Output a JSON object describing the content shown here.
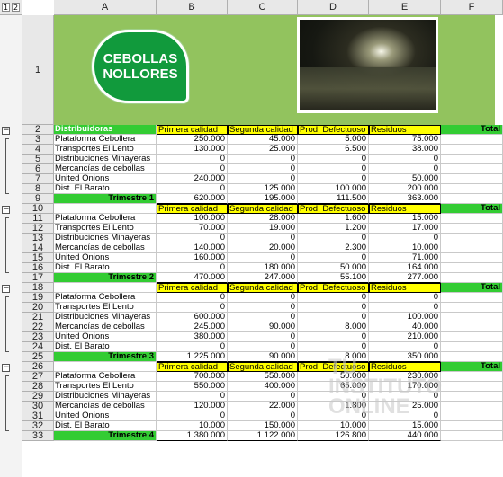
{
  "outline": {
    "levels": [
      "1",
      "2"
    ],
    "collapse_symbol": "−"
  },
  "columns": [
    "A",
    "B",
    "C",
    "D",
    "E",
    "F"
  ],
  "banner": {
    "logo_text": "CEBOLLAS NOLLORES",
    "row_label": "1"
  },
  "headers": {
    "a": "Distribuidoras",
    "b": "Primera calidad",
    "c": "Segunda calidad",
    "d": "Prod. Defectuoso",
    "e": "Residuos",
    "f": "Total"
  },
  "quarters": [
    {
      "header_row": "2",
      "rows": [
        {
          "row": "3",
          "name": "Plataforma Cebollera",
          "b": "250.000",
          "c": "45.000",
          "d": "5.000",
          "e": "75.000"
        },
        {
          "row": "4",
          "name": "Transportes El Lento",
          "b": "130.000",
          "c": "25.000",
          "d": "6.500",
          "e": "38.000"
        },
        {
          "row": "5",
          "name": "Distribuciones Minayeras",
          "b": "0",
          "c": "0",
          "d": "0",
          "e": "0"
        },
        {
          "row": "6",
          "name": "Mercancías de cebollas",
          "b": "0",
          "c": "0",
          "d": "0",
          "e": "0"
        },
        {
          "row": "7",
          "name": "United Onions",
          "b": "240.000",
          "c": "0",
          "d": "0",
          "e": "50.000"
        },
        {
          "row": "8",
          "name": "Dist. El Barato",
          "b": "0",
          "c": "125.000",
          "d": "100.000",
          "e": "200.000"
        }
      ],
      "total": {
        "row": "9",
        "label": "Trimestre 1",
        "b": "620.000",
        "c": "195.000",
        "d": "111.500",
        "e": "363.000"
      }
    },
    {
      "header_row": "10",
      "rows": [
        {
          "row": "11",
          "name": "Plataforma Cebollera",
          "b": "100.000",
          "c": "28.000",
          "d": "1.600",
          "e": "15.000"
        },
        {
          "row": "12",
          "name": "Transportes El Lento",
          "b": "70.000",
          "c": "19.000",
          "d": "1.200",
          "e": "17.000"
        },
        {
          "row": "13",
          "name": "Distribuciones Minayeras",
          "b": "0",
          "c": "0",
          "d": "0",
          "e": "0"
        },
        {
          "row": "14",
          "name": "Mercancías de cebollas",
          "b": "140.000",
          "c": "20.000",
          "d": "2.300",
          "e": "10.000"
        },
        {
          "row": "15",
          "name": "United Onions",
          "b": "160.000",
          "c": "0",
          "d": "0",
          "e": "71.000"
        },
        {
          "row": "16",
          "name": "Dist. El Barato",
          "b": "0",
          "c": "180.000",
          "d": "50.000",
          "e": "164.000"
        }
      ],
      "total": {
        "row": "17",
        "label": "Trimestre 2",
        "b": "470.000",
        "c": "247.000",
        "d": "55.100",
        "e": "277.000"
      }
    },
    {
      "header_row": "18",
      "rows": [
        {
          "row": "19",
          "name": "Plataforma Cebollera",
          "b": "0",
          "c": "0",
          "d": "0",
          "e": "0"
        },
        {
          "row": "20",
          "name": "Transportes El Lento",
          "b": "0",
          "c": "0",
          "d": "0",
          "e": "0"
        },
        {
          "row": "21",
          "name": "Distribuciones Minayeras",
          "b": "600.000",
          "c": "0",
          "d": "0",
          "e": "100.000"
        },
        {
          "row": "22",
          "name": "Mercancías de cebollas",
          "b": "245.000",
          "c": "90.000",
          "d": "8.000",
          "e": "40.000"
        },
        {
          "row": "23",
          "name": "United Onions",
          "b": "380.000",
          "c": "0",
          "d": "0",
          "e": "210.000"
        },
        {
          "row": "24",
          "name": "Dist. El Barato",
          "b": "0",
          "c": "0",
          "d": "0",
          "e": "0"
        }
      ],
      "total": {
        "row": "25",
        "label": "Trimestre 3",
        "b": "1.225.000",
        "c": "90.000",
        "d": "8.000",
        "e": "350.000"
      }
    },
    {
      "header_row": "26",
      "rows": [
        {
          "row": "27",
          "name": "Plataforma Cebollera",
          "b": "700.000",
          "c": "550.000",
          "d": "50.000",
          "e": "230.000"
        },
        {
          "row": "28",
          "name": "Transportes El Lento",
          "b": "550.000",
          "c": "400.000",
          "d": "65.000",
          "e": "170.000"
        },
        {
          "row": "29",
          "name": "Distribuciones Minayeras",
          "b": "0",
          "c": "0",
          "d": "0",
          "e": "0"
        },
        {
          "row": "30",
          "name": "Mercancías de cebollas",
          "b": "120.000",
          "c": "22.000",
          "d": "1.800",
          "e": "25.000"
        },
        {
          "row": "31",
          "name": "United Onions",
          "b": "0",
          "c": "0",
          "d": "0",
          "e": "0"
        },
        {
          "row": "32",
          "name": "Dist. El Barato",
          "b": "10.000",
          "c": "150.000",
          "d": "10.000",
          "e": "15.000"
        }
      ],
      "total": {
        "row": "33",
        "label": "Trimestre 4",
        "b": "1.380.000",
        "c": "1.122.000",
        "d": "126.800",
        "e": "440.000"
      }
    }
  ],
  "watermark": "TU INSTITUTO ONLINE",
  "colors": {
    "banner": "#92c35e",
    "logo": "#119a3c",
    "header_fill": "#ffff00",
    "green_fill": "#33cc33"
  }
}
